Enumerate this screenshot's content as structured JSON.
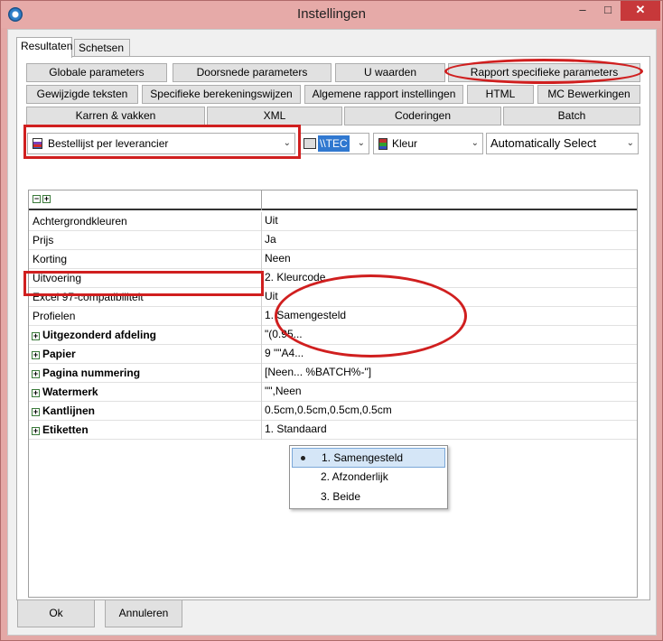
{
  "window": {
    "title": "Instellingen",
    "minimize": "–",
    "maximize": "□",
    "close": "✕"
  },
  "tabs": [
    {
      "label": "Resultaten"
    },
    {
      "label": "Schetsen"
    }
  ],
  "buttons": {
    "row1": [
      "Globale parameters",
      "Doorsnede parameters",
      "U waarden",
      "Rapport specifieke parameters"
    ],
    "row2": [
      "Gewijzigde teksten",
      "Specifieke berekeningswijzen",
      "Algemene rapport instellingen",
      "HTML",
      "MC Bewerkingen"
    ],
    "row3": [
      "Karren & vakken",
      "XML",
      "Coderingen",
      "Batch"
    ]
  },
  "combos": {
    "report": "Bestellijst per leverancier",
    "printer": "\\\\TEC",
    "color": "Kleur",
    "select": "Automatically Select"
  },
  "grid": {
    "rows": [
      {
        "key": "Achtergrondkleuren",
        "value": "Uit"
      },
      {
        "key": "Prijs",
        "value": "Ja"
      },
      {
        "key": "Korting",
        "value": "Neen"
      },
      {
        "key": "Uitvoering",
        "value": "2. Kleurcode"
      },
      {
        "key": "Excel 97-compatibiliteit",
        "value": "Uit"
      },
      {
        "key": "Profielen",
        "value": "1. Samengesteld"
      },
      {
        "key": "Uitgezonderd afdeling",
        "value": "\"(0.95..."
      },
      {
        "key": "Papier",
        "value": "9 \"\"A4..."
      },
      {
        "key": "Pagina nummering",
        "value": "[Neen...                                   %BATCH%-\"]"
      },
      {
        "key": "Watermerk",
        "value": "\"\",Neen"
      },
      {
        "key": "Kantlijnen",
        "value": "0.5cm,0.5cm,0.5cm,0.5cm"
      },
      {
        "key": "Etiketten",
        "value": "1. Standaard"
      }
    ],
    "dropdown": [
      "1. Samengesteld",
      "2. Afzonderlijk",
      "3. Beide"
    ]
  },
  "footer": {
    "ok": "Ok",
    "cancel": "Annuleren"
  },
  "colors": {
    "accent": "#d01f1f",
    "selection": "#d5e6f7",
    "titlebar": "#e6aaa8"
  }
}
